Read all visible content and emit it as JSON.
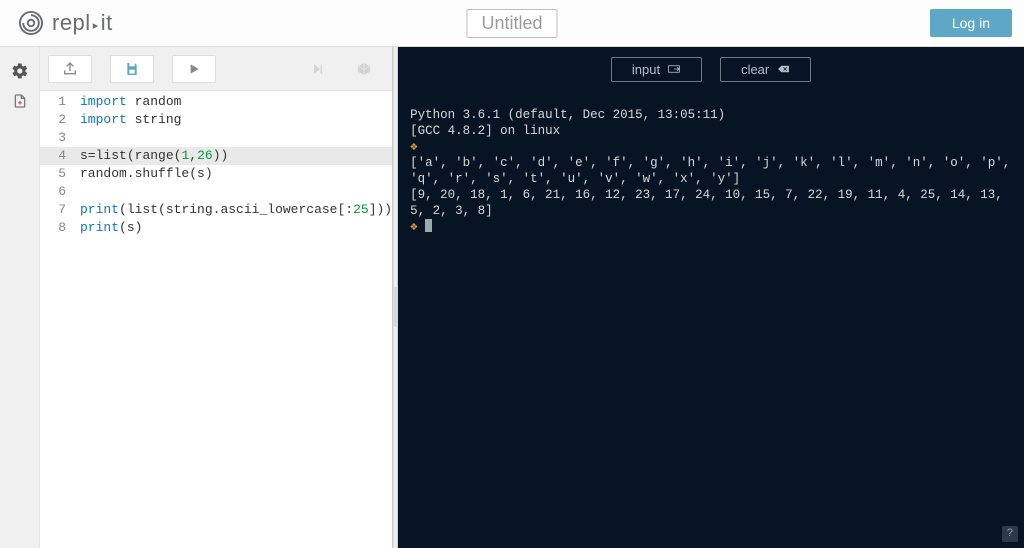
{
  "header": {
    "brand_a": "repl",
    "brand_b": "it",
    "title": "Untitled",
    "login": "Log in"
  },
  "console_buttons": {
    "input": "input",
    "clear": "clear"
  },
  "editor": {
    "lines": [
      {
        "n": 1,
        "segs": [
          [
            "kw",
            "import"
          ],
          [
            "",
            " random"
          ]
        ]
      },
      {
        "n": 2,
        "segs": [
          [
            "kw",
            "import"
          ],
          [
            "",
            " string"
          ]
        ]
      },
      {
        "n": 3,
        "segs": [
          [
            "",
            ""
          ]
        ]
      },
      {
        "n": 4,
        "current": true,
        "segs": [
          [
            "",
            "s="
          ],
          [
            "fn",
            "list"
          ],
          [
            "",
            "("
          ],
          [
            "fn",
            "range"
          ],
          [
            "",
            "("
          ],
          [
            "num",
            "1"
          ],
          [
            "",
            ","
          ],
          [
            "num",
            "26"
          ],
          [
            "",
            "))"
          ]
        ]
      },
      {
        "n": 5,
        "segs": [
          [
            "",
            "random.shuffle(s)"
          ]
        ]
      },
      {
        "n": 6,
        "segs": [
          [
            "",
            ""
          ]
        ]
      },
      {
        "n": 7,
        "segs": [
          [
            "kw",
            "print"
          ],
          [
            "",
            "("
          ],
          [
            "fn",
            "list"
          ],
          [
            "",
            "(string.ascii_lowercase[:"
          ],
          [
            "num",
            "25"
          ],
          [
            "",
            "]))"
          ]
        ]
      },
      {
        "n": 8,
        "segs": [
          [
            "kw",
            "print"
          ],
          [
            "",
            "(s)"
          ]
        ]
      }
    ]
  },
  "console": {
    "line1": "Python 3.6.1 (default, Dec 2015, 13:05:11)",
    "line2": "[GCC 4.8.2] on linux",
    "out1": "['a', 'b', 'c', 'd', 'e', 'f', 'g', 'h', 'i', 'j', 'k', 'l', 'm', 'n', 'o', 'p', 'q', 'r', 's', 't', 'u', 'v', 'w', 'x', 'y']",
    "out2": "[9, 20, 18, 1, 6, 21, 16, 12, 23, 17, 24, 10, 15, 7, 22, 19, 11, 4, 25, 14, 13, 5, 2, 3, 8]"
  },
  "help_badge": "?"
}
